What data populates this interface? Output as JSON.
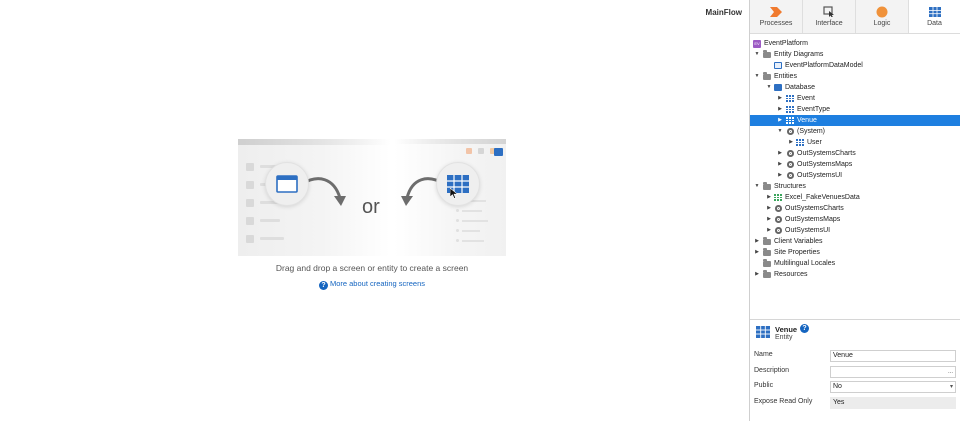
{
  "canvas": {
    "title": "MainFlow",
    "or_text": "or",
    "hint": "Drag and drop a screen or entity to create a screen",
    "help_link": "More about creating screens"
  },
  "tabs": [
    {
      "label": "Processes",
      "icon": "processes-icon",
      "color": "#f07a2e"
    },
    {
      "label": "Interface",
      "icon": "interface-icon",
      "color": "#555555"
    },
    {
      "label": "Logic",
      "icon": "logic-icon",
      "color": "#f0923a"
    },
    {
      "label": "Data",
      "icon": "data-icon",
      "color": "#2d6fc2",
      "active": true
    }
  ],
  "tree": [
    {
      "label": "EventPlatform",
      "depth": 0,
      "arrow": "none",
      "icon": "app"
    },
    {
      "label": "Entity Diagrams",
      "depth": 1,
      "arrow": "down",
      "icon": "folder"
    },
    {
      "label": "EventPlatformDataModel",
      "depth": 2,
      "arrow": "none",
      "icon": "diagram"
    },
    {
      "label": "Entities",
      "depth": 1,
      "arrow": "down",
      "icon": "folder"
    },
    {
      "label": "Database",
      "depth": 2,
      "arrow": "down",
      "icon": "database"
    },
    {
      "label": "Event",
      "depth": 3,
      "arrow": "right",
      "icon": "entity"
    },
    {
      "label": "EventType",
      "depth": 3,
      "arrow": "right",
      "icon": "entity"
    },
    {
      "label": "Venue",
      "depth": 3,
      "arrow": "right",
      "icon": "entity",
      "selected": true
    },
    {
      "label": "(System)",
      "depth": 3,
      "arrow": "down",
      "icon": "module"
    },
    {
      "label": "User",
      "depth": 4,
      "arrow": "right",
      "icon": "entity"
    },
    {
      "label": "OutSystemsCharts",
      "depth": 3,
      "arrow": "right",
      "icon": "module"
    },
    {
      "label": "OutSystemsMaps",
      "depth": 3,
      "arrow": "right",
      "icon": "module"
    },
    {
      "label": "OutSystemsUI",
      "depth": 3,
      "arrow": "right",
      "icon": "module"
    },
    {
      "label": "Structures",
      "depth": 1,
      "arrow": "down",
      "icon": "folder"
    },
    {
      "label": "Excel_FakeVenuesData",
      "depth": 2,
      "arrow": "right",
      "icon": "structure"
    },
    {
      "label": "OutSystemsCharts",
      "depth": 2,
      "arrow": "right",
      "icon": "module"
    },
    {
      "label": "OutSystemsMaps",
      "depth": 2,
      "arrow": "right",
      "icon": "module"
    },
    {
      "label": "OutSystemsUI",
      "depth": 2,
      "arrow": "right",
      "icon": "module"
    },
    {
      "label": "Client Variables",
      "depth": 1,
      "arrow": "right",
      "icon": "folder"
    },
    {
      "label": "Site Properties",
      "depth": 1,
      "arrow": "right",
      "icon": "folder"
    },
    {
      "label": "Multilingual Locales",
      "depth": 1,
      "arrow": "none",
      "icon": "folder"
    },
    {
      "label": "Resources",
      "depth": 1,
      "arrow": "right",
      "icon": "folder"
    }
  ],
  "properties": {
    "name": "Venue",
    "type": "Entity",
    "help": "?",
    "rows": [
      {
        "label": "Name",
        "value": "Venue",
        "kind": "text"
      },
      {
        "label": "Description",
        "value": "",
        "kind": "text",
        "suffix": "..."
      },
      {
        "label": "Public",
        "value": "No",
        "kind": "select",
        "suffix": "▾"
      },
      {
        "label": "Expose Read Only",
        "value": "Yes",
        "kind": "readonly"
      }
    ]
  }
}
